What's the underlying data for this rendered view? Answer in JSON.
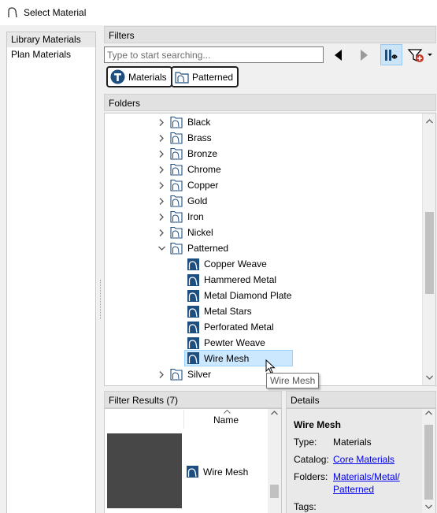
{
  "window": {
    "title": "Select Material"
  },
  "left_panel": {
    "items": [
      {
        "label": "Library Materials",
        "selected": true
      },
      {
        "label": "Plan Materials",
        "selected": false
      }
    ]
  },
  "filters": {
    "header": "Filters",
    "search_placeholder": "Type to start searching...",
    "search_value": "",
    "chips": [
      {
        "label": "Materials",
        "icon": "materials-catalog-icon"
      },
      {
        "label": "Patterned",
        "icon": "folder-icon"
      }
    ]
  },
  "folders": {
    "header": "Folders",
    "items": [
      {
        "label": "Black",
        "type": "folder",
        "expanded": false,
        "selected": false
      },
      {
        "label": "Brass",
        "type": "folder",
        "expanded": false,
        "selected": false
      },
      {
        "label": "Bronze",
        "type": "folder",
        "expanded": false,
        "selected": false
      },
      {
        "label": "Chrome",
        "type": "folder",
        "expanded": false,
        "selected": false
      },
      {
        "label": "Copper",
        "type": "folder",
        "expanded": false,
        "selected": false
      },
      {
        "label": "Gold",
        "type": "folder",
        "expanded": false,
        "selected": false
      },
      {
        "label": "Iron",
        "type": "folder",
        "expanded": false,
        "selected": false
      },
      {
        "label": "Nickel",
        "type": "folder",
        "expanded": false,
        "selected": false
      },
      {
        "label": "Patterned",
        "type": "folder",
        "expanded": true,
        "selected": false
      },
      {
        "label": "Copper Weave",
        "type": "material",
        "selected": false
      },
      {
        "label": "Hammered Metal",
        "type": "material",
        "selected": false
      },
      {
        "label": "Metal Diamond Plate",
        "type": "material",
        "selected": false
      },
      {
        "label": "Metal Stars",
        "type": "material",
        "selected": false
      },
      {
        "label": "Perforated Metal",
        "type": "material",
        "selected": false
      },
      {
        "label": "Pewter Weave",
        "type": "material",
        "selected": false
      },
      {
        "label": "Wire Mesh",
        "type": "material",
        "selected": true
      },
      {
        "label": "Silver",
        "type": "folder",
        "expanded": false,
        "selected": false
      }
    ],
    "tooltip": "Wire Mesh"
  },
  "filter_results": {
    "header": "Filter Results (7)",
    "column_name": "Name",
    "rows": [
      {
        "name": "Wire Mesh",
        "swatch_color": "#474747"
      }
    ]
  },
  "details": {
    "header": "Details",
    "title": "Wire Mesh",
    "type_label": "Type:",
    "type_value": "Materials",
    "catalog_label": "Catalog:",
    "catalog_value": "Core Materials",
    "folders_label": "Folders:",
    "folders_value_line1": "Materials/Metal/",
    "folders_value_line2": "Patterned",
    "tags_label": "Tags:"
  },
  "colors": {
    "accent_icon": "#1c4e80",
    "selection_bg": "#cce8ff",
    "link": "#0000ee",
    "swatch": "#474747"
  }
}
